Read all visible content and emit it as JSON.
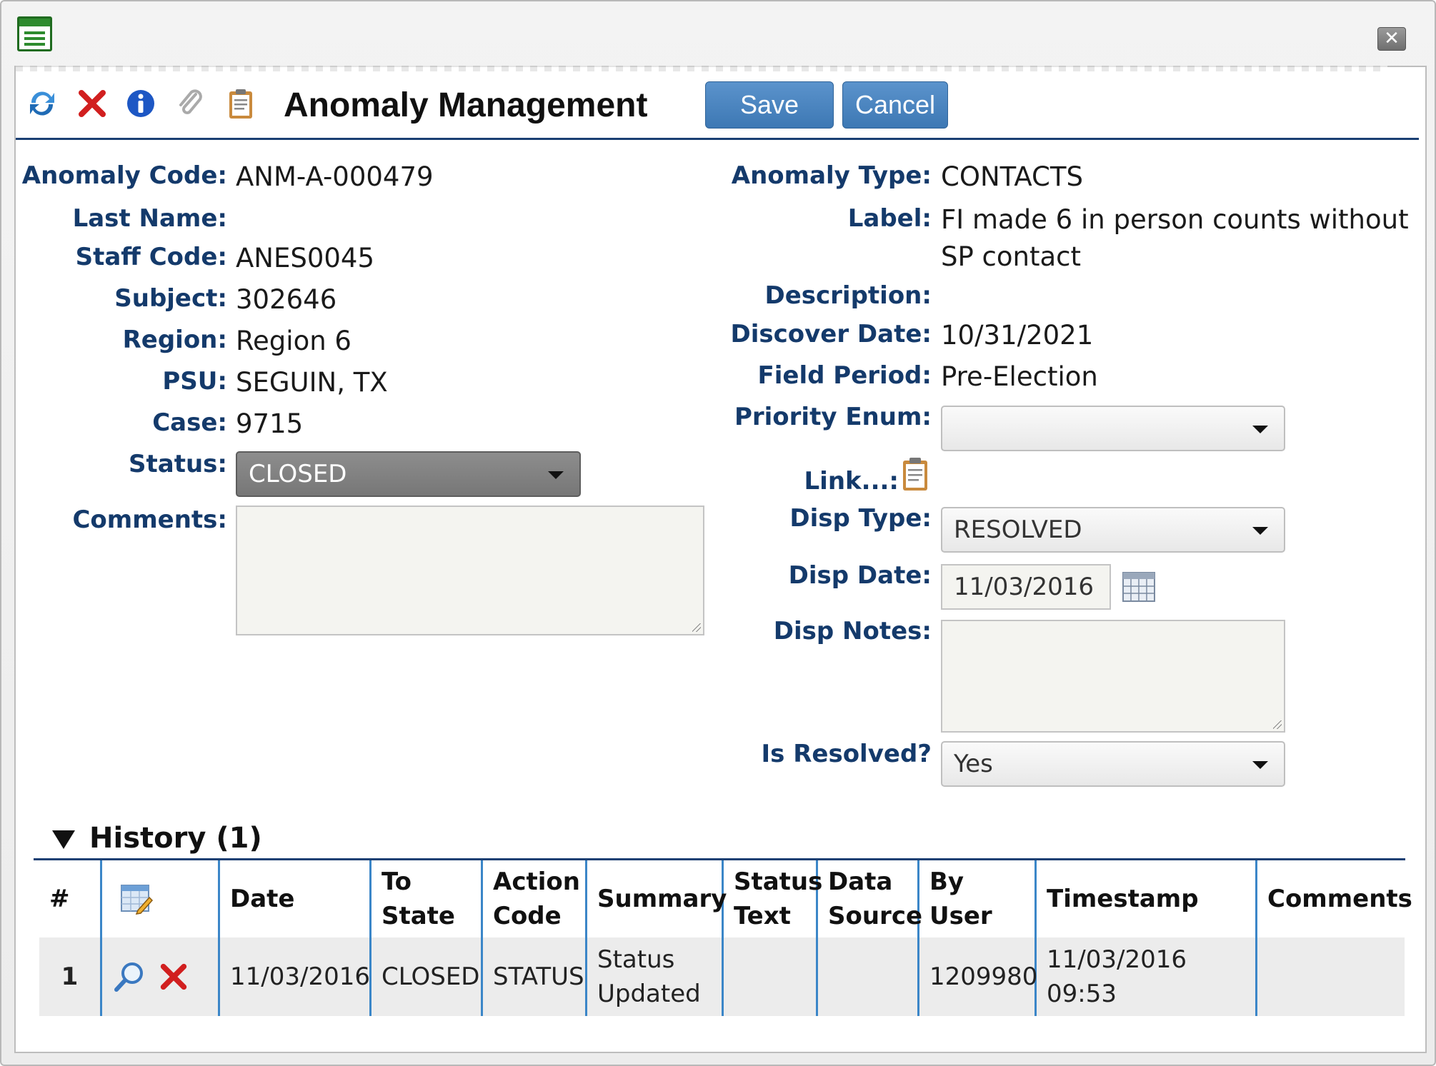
{
  "window": {
    "close_symbol": "✕"
  },
  "toolbar": {
    "title": "Anomaly Management",
    "save_label": "Save",
    "cancel_label": "Cancel",
    "icons": [
      "refresh-icon",
      "delete-icon",
      "info-icon",
      "attach-icon",
      "clipboard-icon"
    ]
  },
  "left": {
    "anomaly_code_label": "Anomaly Code:",
    "anomaly_code": "ANM-A-000479",
    "last_name_label": "Last Name:",
    "last_name": "",
    "staff_code_label": "Staff Code:",
    "staff_code": "ANES0045",
    "subject_label": "Subject:",
    "subject": "302646",
    "region_label": "Region:",
    "region": "Region 6",
    "psu_label": "PSU:",
    "psu": "SEGUIN, TX",
    "case_label": "Case:",
    "case": "9715",
    "status_label": "Status:",
    "status": "CLOSED",
    "comments_label": "Comments:",
    "comments": ""
  },
  "right": {
    "anomaly_type_label": "Anomaly Type:",
    "anomaly_type": "CONTACTS",
    "label_label": "Label:",
    "label_line1": "FI made 6 in person counts without",
    "label_line2": "SP contact",
    "description_label": "Description:",
    "description": "",
    "discover_date_label": "Discover Date:",
    "discover_date": "10/31/2021",
    "field_period_label": "Field Period:",
    "field_period": "Pre-Election",
    "priority_enum_label": "Priority Enum:",
    "priority_enum": "",
    "link_label": "Link...:",
    "disp_type_label": "Disp Type:",
    "disp_type": "RESOLVED",
    "disp_date_label": "Disp Date:",
    "disp_date": "11/03/2016",
    "disp_notes_label": "Disp Notes:",
    "disp_notes": "",
    "is_resolved_label": "Is Resolved?",
    "is_resolved": "Yes"
  },
  "history": {
    "title": "History (1)",
    "columns": {
      "num": "#",
      "date": "Date",
      "to_state_1": "To",
      "to_state_2": "State",
      "action_code_1": "Action",
      "action_code_2": "Code",
      "summary": "Summary",
      "status_text_1": "Status",
      "status_text_2": "Text",
      "data_source_1": "Data",
      "data_source_2": "Source",
      "by_user": "By User",
      "timestamp": "Timestamp",
      "comments": "Comments"
    },
    "rows": [
      {
        "num": "1",
        "date": "11/03/2016",
        "to_state": "CLOSED",
        "action_code": "STATUS",
        "summary_1": "Status",
        "summary_2": "Updated",
        "status_text": "",
        "data_source": "",
        "by_user": "1209980",
        "timestamp": "11/03/2016 09:53",
        "comments": ""
      }
    ]
  },
  "colors": {
    "label": "#143a6b",
    "button": "#4a84c0",
    "grid_line": "#3b86c8",
    "row_bg": "#ececec"
  }
}
